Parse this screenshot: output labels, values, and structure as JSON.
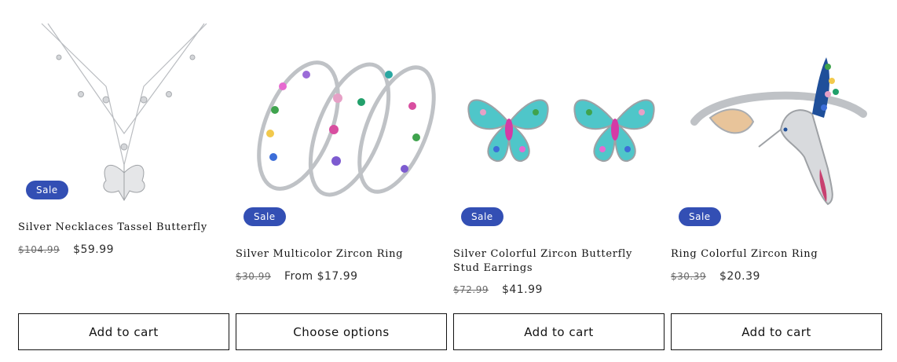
{
  "products": [
    {
      "badge": "Sale",
      "title": "Silver Necklaces Tassel Butterfly",
      "old_price": "$104.99",
      "price": "$59.99",
      "button": "Add to cart"
    },
    {
      "badge": "Sale",
      "title": "Silver Multicolor Zircon Ring",
      "old_price": "$30.99",
      "price": "From $17.99",
      "button": "Choose options"
    },
    {
      "badge": "Sale",
      "title": "Silver Colorful Zircon Butterfly Stud Earrings",
      "old_price": "$72.99",
      "price": "$41.99",
      "button": "Add to cart"
    },
    {
      "badge": "Sale",
      "title": "Ring Colorful Zircon Ring",
      "old_price": "$30.39",
      "price": "$20.39",
      "button": "Add to cart"
    }
  ],
  "colors": {
    "badge": "#334fb4",
    "text": "#121212",
    "old_price": "#6a6a6a"
  }
}
